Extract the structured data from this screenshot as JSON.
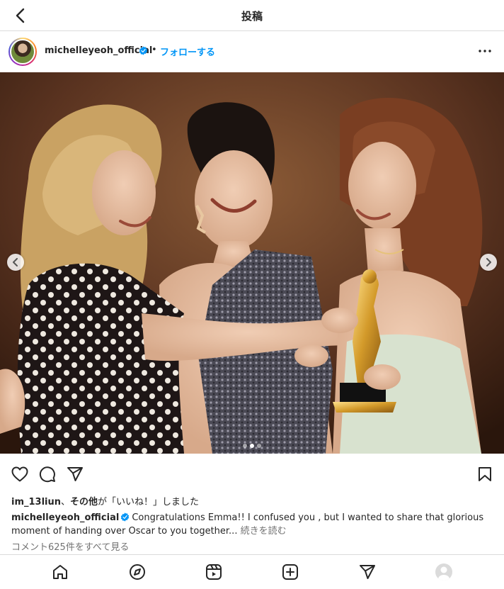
{
  "topbar": {
    "title": "投稿",
    "back_icon": "chevron-left-icon"
  },
  "post": {
    "username": "michelleyeoh_official",
    "verified": true,
    "separator": "•",
    "follow_label": "フォローする",
    "more_icon": "more-horizontal-icon",
    "photo": {
      "carousel_index": 2,
      "carousel_count": 3
    }
  },
  "actions": {
    "like_icon": "heart-icon",
    "comment_icon": "comment-icon",
    "share_icon": "send-icon",
    "save_icon": "bookmark-icon"
  },
  "likes": {
    "user": "im_13liun",
    "sep": "、",
    "others": "その他",
    "suffix": "が「いいね！」しました"
  },
  "caption": {
    "username": "michelleyeoh_official",
    "text": "Congratulations Emma!! I confused you , but I wanted to share that glorious moment of handing over Oscar to you together...",
    "more": "続きを読む"
  },
  "comments_link": "コメント625件をすべて見る",
  "bottom_nav": [
    "home-icon",
    "explore-icon",
    "reels-icon",
    "new-post-icon",
    "direct-icon",
    "profile-icon"
  ],
  "colors": {
    "link_blue": "#0095f6",
    "verified_blue": "#0095f6",
    "text": "#262626",
    "muted": "#737373",
    "border": "#dbdbdb"
  }
}
